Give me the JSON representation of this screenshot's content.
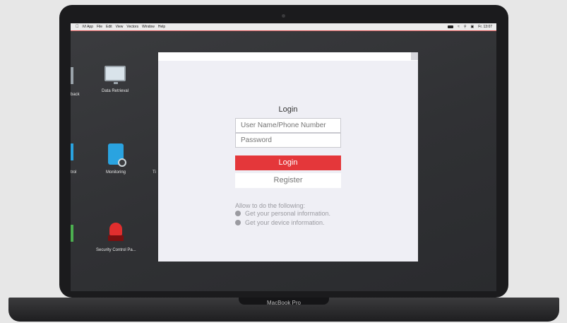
{
  "device_label": "MacBook Pro",
  "menubar": {
    "items": [
      "iVi App",
      "File",
      "Edit",
      "View",
      "Vectors",
      "Window",
      "Help"
    ],
    "clock": "Fr. 13:07"
  },
  "desktop": {
    "icons": [
      {
        "label": "back"
      },
      {
        "label": "Data Retrieval"
      },
      {
        "label": "trol"
      },
      {
        "label": "Monitoring"
      },
      {
        "label": "Ti"
      },
      {
        "label": "Security Control Pa..."
      }
    ]
  },
  "dialog": {
    "title": "Login",
    "username_placeholder": "User Name/Phone Number",
    "password_placeholder": "Password",
    "login_button": "Login",
    "register_button": "Register",
    "allow_title": "Allow to do the following:",
    "permissions": [
      "Get your personal information.",
      "Get your device information."
    ]
  },
  "colors": {
    "accent": "#e4373a",
    "dialog_bg": "#efeff5"
  }
}
